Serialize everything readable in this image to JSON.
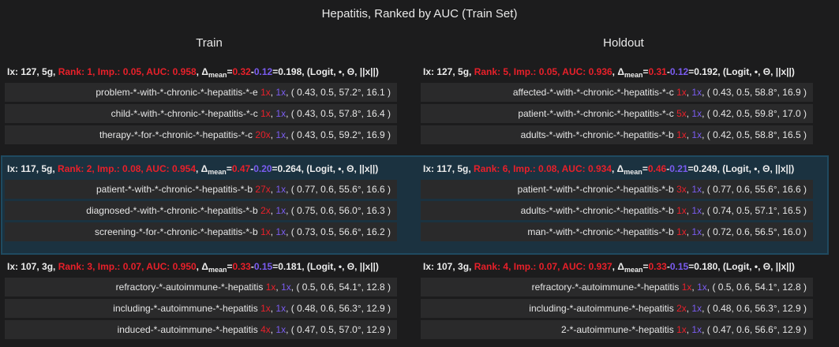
{
  "title": "Hepatitis, Ranked by AUC (Train Set)",
  "columns": {
    "train": "Train",
    "holdout": "Holdout"
  },
  "groups": [
    {
      "train": {
        "ix": "Ix: 127, 5g,",
        "rank": "Rank: 1, Imp.: 0.05, AUC: 0.958",
        "delta_pre": ", Δ",
        "sub": "mean",
        "eq": "=",
        "a": "0.32",
        "minus": "-",
        "b": "0.12",
        "tail": "=0.198, (Logit, •, Θ, ||x||)",
        "rows": [
          {
            "label": "problem-*-with-*-chronic-*-hepatitis-*-e",
            "c1": "1x",
            "c2": "1x",
            "rest": ", ( 0.43, 0.5, 57.2°, 16.1 )"
          },
          {
            "label": "child-*-with-*-chronic-*-hepatitis-*-c",
            "c1": "1x",
            "c2": "1x",
            "rest": ", ( 0.43, 0.5, 57.8°, 16.4 )"
          },
          {
            "label": "therapy-*-for-*-chronic-*-hepatitis-*-c",
            "c1": "20x",
            "c2": "1x",
            "rest": ", ( 0.43, 0.5, 59.2°, 16.9 )"
          }
        ]
      },
      "holdout": {
        "ix": "Ix: 127, 5g,",
        "rank": "Rank: 5, Imp.: 0.05, AUC: 0.936",
        "delta_pre": ", Δ",
        "sub": "mean",
        "eq": "=",
        "a": "0.31",
        "minus": "-",
        "b": "0.12",
        "tail": "=0.192, (Logit, •, Θ, ||x||)",
        "rows": [
          {
            "label": "affected-*-with-*-chronic-*-hepatitis-*-c",
            "c1": "1x",
            "c2": "1x",
            "rest": ", ( 0.43, 0.5, 58.8°, 16.9 )"
          },
          {
            "label": "patient-*-with-*-chronic-*-hepatitis-*-c",
            "c1": "5x",
            "c2": "1x",
            "rest": ", ( 0.42, 0.5, 59.8°, 17.0 )"
          },
          {
            "label": "adults-*-with-*-chronic-*-hepatitis-*-b",
            "c1": "1x",
            "c2": "1x",
            "rest": ", ( 0.42, 0.5, 58.8°, 16.5 )"
          }
        ]
      }
    },
    {
      "train": {
        "ix": "Ix: 117, 5g,",
        "rank": "Rank: 2, Imp.: 0.08, AUC: 0.954",
        "delta_pre": ", Δ",
        "sub": "mean",
        "eq": "=",
        "a": "0.47",
        "minus": "-",
        "b": "0.20",
        "tail": "=0.264, (Logit, •, Θ, ||x||)",
        "rows": [
          {
            "label": "patient-*-with-*-chronic-*-hepatitis-*-b",
            "c1": "27x",
            "c2": "1x",
            "rest": ", ( 0.77, 0.6, 55.6°, 16.6 )"
          },
          {
            "label": "diagnosed-*-with-*-chronic-*-hepatitis-*-b",
            "c1": "2x",
            "c2": "1x",
            "rest": ", ( 0.75, 0.6, 56.0°, 16.3 )"
          },
          {
            "label": "screening-*-for-*-chronic-*-hepatitis-*-b",
            "c1": "1x",
            "c2": "1x",
            "rest": ", ( 0.73, 0.5, 56.6°, 16.2 )"
          }
        ]
      },
      "holdout": {
        "ix": "Ix: 117, 5g,",
        "rank": "Rank: 6, Imp.: 0.08, AUC: 0.934",
        "delta_pre": ", Δ",
        "sub": "mean",
        "eq": "=",
        "a": "0.46",
        "minus": "-",
        "b": "0.21",
        "tail": "=0.249, (Logit, •, Θ, ||x||)",
        "rows": [
          {
            "label": "patient-*-with-*-chronic-*-hepatitis-*-b",
            "c1": "3x",
            "c2": "1x",
            "rest": ", ( 0.77, 0.6, 55.6°, 16.6 )"
          },
          {
            "label": "adults-*-with-*-chronic-*-hepatitis-*-b",
            "c1": "1x",
            "c2": "1x",
            "rest": ", ( 0.74, 0.5, 57.1°, 16.5 )"
          },
          {
            "label": "man-*-with-*-chronic-*-hepatitis-*-b",
            "c1": "1x",
            "c2": "1x",
            "rest": ", ( 0.72, 0.6, 56.5°, 16.0 )"
          }
        ]
      }
    },
    {
      "train": {
        "ix": "Ix: 107, 3g,",
        "rank": "Rank: 3, Imp.: 0.07, AUC: 0.950",
        "delta_pre": ", Δ",
        "sub": "mean",
        "eq": "=",
        "a": "0.33",
        "minus": "-",
        "b": "0.15",
        "tail": "=0.181, (Logit, •, Θ, ||x||)",
        "rows": [
          {
            "label": "refractory-*-autoimmune-*-hepatitis",
            "c1": "1x",
            "c2": "1x",
            "rest": ", ( 0.5, 0.6, 54.1°, 12.8 )"
          },
          {
            "label": "including-*-autoimmune-*-hepatitis",
            "c1": "1x",
            "c2": "1x",
            "rest": ", ( 0.48, 0.6, 56.3°, 12.9 )"
          },
          {
            "label": "induced-*-autoimmune-*-hepatitis",
            "c1": "4x",
            "c2": "1x",
            "rest": ", ( 0.47, 0.5, 57.0°, 12.9 )"
          }
        ]
      },
      "holdout": {
        "ix": "Ix: 107, 3g,",
        "rank": "Rank: 4, Imp.: 0.07, AUC: 0.937",
        "delta_pre": ", Δ",
        "sub": "mean",
        "eq": "=",
        "a": "0.33",
        "minus": "-",
        "b": "0.15",
        "tail": "=0.180, (Logit, •, Θ, ||x||)",
        "rows": [
          {
            "label": "refractory-*-autoimmune-*-hepatitis",
            "c1": "1x",
            "c2": "1x",
            "rest": ", ( 0.5, 0.6, 54.1°, 12.8 )"
          },
          {
            "label": "including-*-autoimmune-*-hepatitis",
            "c1": "2x",
            "c2": "1x",
            "rest": ", ( 0.48, 0.6, 56.3°, 12.9 )"
          },
          {
            "label": "2-*-autoimmune-*-hepatitis",
            "c1": "1x",
            "c2": "1x",
            "rest": ", ( 0.47, 0.6, 56.6°, 12.9 )"
          }
        ]
      }
    }
  ]
}
